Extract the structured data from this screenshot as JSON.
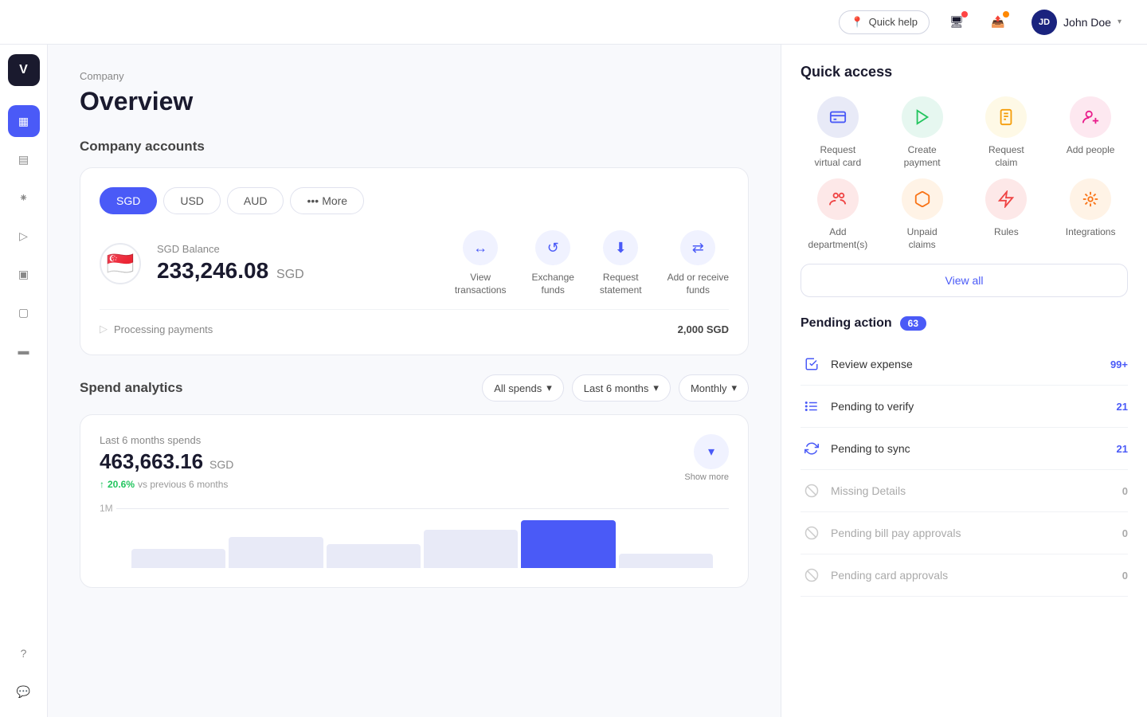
{
  "topbar": {
    "quick_help": "Quick help",
    "user_initials": "JD",
    "user_name": "John Doe"
  },
  "sidebar": {
    "logo": "V",
    "items": [
      {
        "id": "overview",
        "icon": "▦",
        "active": true
      },
      {
        "id": "analytics",
        "icon": "▤"
      },
      {
        "id": "cards",
        "icon": "⁕"
      },
      {
        "id": "payments",
        "icon": "▷"
      },
      {
        "id": "reports",
        "icon": "▣"
      },
      {
        "id": "wallet",
        "icon": "▢"
      },
      {
        "id": "docs",
        "icon": "▬"
      }
    ],
    "bottom": [
      {
        "id": "help",
        "icon": "?"
      },
      {
        "id": "chat",
        "icon": "💬"
      }
    ]
  },
  "main": {
    "breadcrumb": "Company",
    "page_title": "Overview",
    "company_accounts_title": "Company accounts",
    "currency_tabs": [
      {
        "label": "SGD",
        "active": true
      },
      {
        "label": "USD",
        "active": false
      },
      {
        "label": "AUD",
        "active": false
      },
      {
        "label": "More",
        "active": false
      }
    ],
    "account": {
      "flag": "🇸🇬",
      "label": "SGD Balance",
      "amount": "233,246.08",
      "currency": "SGD"
    },
    "actions": [
      {
        "label": "View\ntransactions",
        "icon": "↔"
      },
      {
        "label": "Exchange\nfunds",
        "icon": "↺"
      },
      {
        "label": "Request\nstatement",
        "icon": "⬇"
      },
      {
        "label": "Add or receive\nfunds",
        "icon": "⇄"
      }
    ],
    "processing": {
      "label": "Processing payments",
      "amount": "2,000 SGD"
    },
    "analytics": {
      "title": "Spend analytics",
      "filters": [
        {
          "label": "All spends"
        },
        {
          "label": "Last 6 months"
        },
        {
          "label": "Monthly"
        }
      ],
      "spend_label": "Last 6 months spends",
      "spend_amount": "463,663.16",
      "spend_currency": "SGD",
      "change_pct": "20.6%",
      "vs_text": "vs previous 6 months",
      "show_more": "Show more",
      "chart_label": "1M"
    }
  },
  "right_panel": {
    "quick_access_title": "Quick access",
    "items": [
      {
        "label": "Request\nvirtual card",
        "icon": "▣",
        "color": "blue"
      },
      {
        "label": "Create\npayment",
        "icon": "▷",
        "color": "green"
      },
      {
        "label": "Request\nclaim",
        "icon": "📋",
        "color": "yellow"
      },
      {
        "label": "Add\npeople",
        "icon": "👤+",
        "color": "pink"
      },
      {
        "label": "Add\ndepartment(s)",
        "icon": "👥",
        "color": "red"
      },
      {
        "label": "Unpaid\nclaims",
        "icon": "📦",
        "color": "orange"
      },
      {
        "label": "Rules",
        "icon": "⚡",
        "color": "red"
      },
      {
        "label": "Integrations",
        "icon": "✺",
        "color": "orange"
      }
    ],
    "view_all": "View all",
    "pending_title": "Pending action",
    "pending_count": "63",
    "pending_items": [
      {
        "label": "Review expense",
        "count": "99+",
        "muted": false
      },
      {
        "label": "Pending to verify",
        "count": "21",
        "muted": false
      },
      {
        "label": "Pending to sync",
        "count": "21",
        "muted": false
      },
      {
        "label": "Missing Details",
        "count": "0",
        "muted": true
      },
      {
        "label": "Pending bill pay approvals",
        "count": "0",
        "muted": true
      },
      {
        "label": "Pending card approvals",
        "count": "0",
        "muted": true
      }
    ]
  }
}
